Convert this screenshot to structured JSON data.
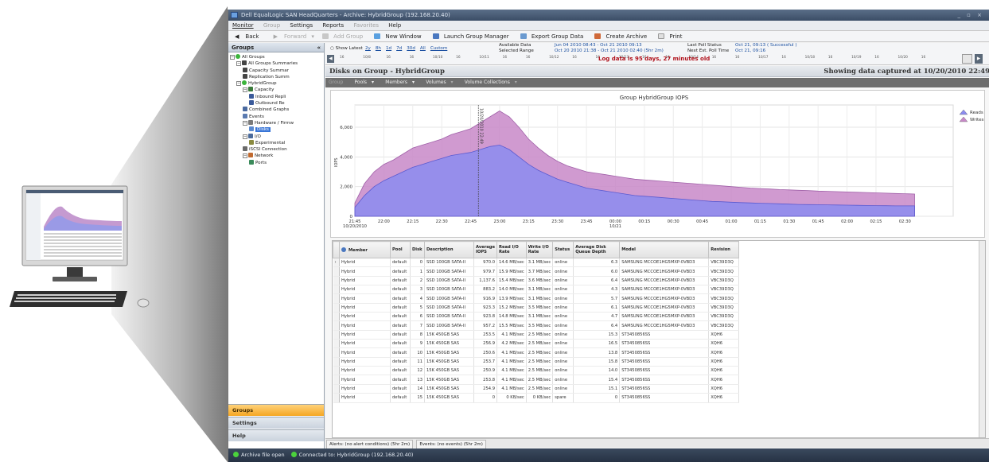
{
  "window": {
    "title": "Dell EqualLogic SAN HeadQuarters - Archive: HybridGroup (192.168.20.40)",
    "controls": "_ ▫ ×"
  },
  "menu": {
    "monitor": "Monitor",
    "group": "Group",
    "settings": "Settings",
    "reports": "Reports",
    "favorites": "Favorites",
    "help": "Help"
  },
  "toolbar": {
    "back": "Back",
    "forward": "Forward",
    "add_group": "Add Group",
    "new_window": "New Window",
    "launch_group_manager": "Launch Group Manager",
    "export_group_data": "Export Group Data",
    "create_archive": "Create Archive",
    "print": "Print"
  },
  "sidebar": {
    "title": "Groups",
    "collapse": "«",
    "tree": [
      {
        "label": "All Groups",
        "indent": 0,
        "expander": "−",
        "icon": "green-check-icon"
      },
      {
        "label": "All Groups Summaries",
        "indent": 1,
        "expander": "−",
        "icon": "sigma-icon"
      },
      {
        "label": "Capacity Summar",
        "indent": 2,
        "expander": "",
        "icon": "sigma-icon"
      },
      {
        "label": "Replication Summ",
        "indent": 2,
        "expander": "",
        "icon": "sigma-icon"
      },
      {
        "label": "HybridGroup",
        "indent": 1,
        "expander": "−",
        "icon": "green-check-icon"
      },
      {
        "label": "Capacity",
        "indent": 2,
        "expander": "−",
        "icon": "capacity-icon"
      },
      {
        "label": "Inbound Repli",
        "indent": 3,
        "expander": "",
        "icon": "inbound-icon"
      },
      {
        "label": "Outbound Re",
        "indent": 3,
        "expander": "",
        "icon": "outbound-icon"
      },
      {
        "label": "Combined Graphs",
        "indent": 2,
        "expander": "",
        "icon": "graph-icon"
      },
      {
        "label": "Events",
        "indent": 2,
        "expander": "",
        "icon": "events-icon"
      },
      {
        "label": "Hardware / Firmw",
        "indent": 2,
        "expander": "−",
        "icon": "hardware-icon"
      },
      {
        "label": "Disks",
        "indent": 3,
        "expander": "",
        "icon": "disk-icon",
        "selected": true
      },
      {
        "label": "I/O",
        "indent": 2,
        "expander": "−",
        "icon": "io-icon"
      },
      {
        "label": "Experimental",
        "indent": 3,
        "expander": "",
        "icon": "experimental-icon"
      },
      {
        "label": "iSCSI Connection",
        "indent": 2,
        "expander": "",
        "icon": "iscsi-icon"
      },
      {
        "label": "Network",
        "indent": 2,
        "expander": "−",
        "icon": "network-icon"
      },
      {
        "label": "Ports",
        "indent": 3,
        "expander": "",
        "icon": "ports-icon"
      }
    ],
    "nav": {
      "groups": "Groups",
      "settings": "Settings",
      "help": "Help"
    }
  },
  "timebar": {
    "show_latest": "Show Latest",
    "ranges": [
      "2y",
      "8h",
      "1d",
      "7d",
      "30d",
      "All",
      "Custom"
    ],
    "available_data_label": "Available Data",
    "available_data_value": "Jun 04 2010 08:43 - Oct 21 2010 09:13",
    "selected_range_label": "Selected Range",
    "selected_range_value": "Oct 20 2010 21:38 - Oct 21 2010 02:40 (5hr 2m)",
    "last_poll_label": "Last Poll Status",
    "last_poll_value": "Oct 21, 09:13 ( Successful )",
    "next_poll_label": "Next Est. Poll Time",
    "next_poll_value": "Oct 21, 09:16",
    "ticks": [
      "16",
      "10/8",
      "16",
      "16",
      "10/10",
      "16",
      "10/11",
      "16",
      "16",
      "10/12",
      "16",
      "16",
      "10/13",
      "16",
      "16",
      "10/14",
      "16",
      "16",
      "10/17",
      "16",
      "10/18",
      "16",
      "10/19",
      "16",
      "10/20",
      "16"
    ],
    "log_warning": "Log data is 95 days, 27 minutes old"
  },
  "header": {
    "title": "Disks on Group - HybridGroup",
    "captured": "Showing data captured at 10/20/2010 22:49"
  },
  "subtabs": {
    "group": "Group",
    "pools": "Pools",
    "members": "Members",
    "volumes": "Volumes",
    "volume_collections": "Volume Collections"
  },
  "chart_data": {
    "type": "area",
    "title": "Group HybridGroup IOPS",
    "ylabel": "IOPS",
    "xlabel": "",
    "ylim": [
      0,
      7500
    ],
    "yticks": [
      0,
      2000,
      4000,
      6000
    ],
    "ytick_labels": [
      "0",
      "2,000",
      "4,000",
      "6,000"
    ],
    "xtick_labels": [
      "21:45\n10/20/2010",
      "22:00",
      "22:15",
      "22:30",
      "22:45",
      "23:00",
      "23:15",
      "23:30",
      "23:45",
      "00:00\n10/21",
      "00:15",
      "00:30",
      "00:45",
      "01:00",
      "01:15",
      "01:30",
      "01:45",
      "02:00",
      "02:15",
      "02:30"
    ],
    "marker_label": "10/20/2010 22:49",
    "grid": true,
    "legend": "right",
    "x_minutes": [
      0,
      5,
      10,
      15,
      20,
      25,
      30,
      35,
      40,
      45,
      50,
      55,
      60,
      65,
      70,
      75,
      80,
      85,
      90,
      95,
      100,
      105,
      110,
      115,
      120,
      125,
      130,
      135,
      140,
      145,
      150,
      155,
      160,
      165,
      170,
      175,
      180,
      185,
      190,
      195,
      200,
      205,
      210,
      215,
      220,
      225,
      230,
      235,
      240,
      245,
      250,
      255,
      260,
      265,
      270,
      275,
      280,
      285,
      290
    ],
    "series": [
      {
        "name": "Reads",
        "color": "#8c8cf0",
        "values": [
          600,
          1400,
          2000,
          2400,
          2700,
          3000,
          3300,
          3500,
          3700,
          3900,
          4100,
          4200,
          4300,
          4500,
          4700,
          4800,
          4500,
          4000,
          3500,
          3100,
          2800,
          2500,
          2300,
          2100,
          1900,
          1800,
          1700,
          1600,
          1500,
          1400,
          1350,
          1300,
          1250,
          1200,
          1150,
          1100,
          1050,
          1000,
          980,
          950,
          920,
          900,
          880,
          860,
          840,
          820,
          800,
          790,
          780,
          770,
          760,
          750,
          740,
          730,
          720,
          710,
          700,
          700,
          700
        ]
      },
      {
        "name": "Writes",
        "color": "#c888c8",
        "values": [
          900,
          2200,
          3000,
          3500,
          3800,
          4200,
          4600,
          4800,
          5000,
          5200,
          5500,
          5700,
          5900,
          6300,
          6700,
          7100,
          6700,
          6000,
          5200,
          4600,
          4100,
          3700,
          3400,
          3200,
          3000,
          2900,
          2800,
          2700,
          2600,
          2500,
          2450,
          2400,
          2350,
          2300,
          2250,
          2200,
          2150,
          2100,
          2050,
          2000,
          1950,
          1900,
          1870,
          1840,
          1800,
          1780,
          1750,
          1730,
          1700,
          1680,
          1660,
          1640,
          1620,
          1600,
          1580,
          1560,
          1540,
          1520,
          1500
        ]
      }
    ]
  },
  "table": {
    "columns": [
      "Member",
      "Pool",
      "Disk",
      "Description",
      "Average IOPS",
      "Read I/O Rate",
      "Write I/O Rate",
      "Status",
      "Average Disk Queue Depth",
      "Model",
      "Revision"
    ],
    "rows": [
      [
        "Hybrid",
        "default",
        "0",
        "SSD 100GB SATA-II",
        "970.0",
        "14.6 MB/sec",
        "3.1 MB/sec",
        "online",
        "6.3",
        "SAMSUNG MCCOE1HG5MXP-0VBD3",
        "VBC39D3Q"
      ],
      [
        "Hybrid",
        "default",
        "1",
        "SSD 100GB SATA-II",
        "979.7",
        "15.9 MB/sec",
        "3.7 MB/sec",
        "online",
        "6.0",
        "SAMSUNG MCCOE1HG5MXP-0VBD3",
        "VBC39D3Q"
      ],
      [
        "Hybrid",
        "default",
        "2",
        "SSD 100GB SATA-II",
        "1,137.6",
        "15.4 MB/sec",
        "3.6 MB/sec",
        "online",
        "6.4",
        "SAMSUNG MCCOE1HG5MXP-0VBD3",
        "VBC39D3Q"
      ],
      [
        "Hybrid",
        "default",
        "3",
        "SSD 100GB SATA-II",
        "883.2",
        "14.0 MB/sec",
        "3.1 MB/sec",
        "online",
        "4.3",
        "SAMSUNG MCCOE1HG5MXP-0VBD3",
        "VBC39D3Q"
      ],
      [
        "Hybrid",
        "default",
        "4",
        "SSD 100GB SATA-II",
        "916.9",
        "13.9 MB/sec",
        "3.1 MB/sec",
        "online",
        "5.7",
        "SAMSUNG MCCOE1HG5MXP-0VBD3",
        "VBC39D3Q"
      ],
      [
        "Hybrid",
        "default",
        "5",
        "SSD 100GB SATA-II",
        "923.3",
        "15.2 MB/sec",
        "3.5 MB/sec",
        "online",
        "6.1",
        "SAMSUNG MCCOE1HG5MXP-0VBD3",
        "VBC39D3Q"
      ],
      [
        "Hybrid",
        "default",
        "6",
        "SSD 100GB SATA-II",
        "923.8",
        "14.8 MB/sec",
        "3.1 MB/sec",
        "online",
        "4.7",
        "SAMSUNG MCCOE1HG5MXP-0VBD3",
        "VBC39D3Q"
      ],
      [
        "Hybrid",
        "default",
        "7",
        "SSD 100GB SATA-II",
        "957.2",
        "15.5 MB/sec",
        "3.5 MB/sec",
        "online",
        "6.4",
        "SAMSUNG MCCOE1HG5MXP-0VBD3",
        "VBC39D3Q"
      ],
      [
        "Hybrid",
        "default",
        "8",
        "15K 450GB SAS",
        "253.5",
        "4.1 MB/sec",
        "2.5 MB/sec",
        "online",
        "15.3",
        "ST3450856SS",
        "XQH6"
      ],
      [
        "Hybrid",
        "default",
        "9",
        "15K 450GB SAS",
        "256.9",
        "4.2 MB/sec",
        "2.5 MB/sec",
        "online",
        "16.5",
        "ST3450856SS",
        "XQH6"
      ],
      [
        "Hybrid",
        "default",
        "10",
        "15K 450GB SAS",
        "250.6",
        "4.1 MB/sec",
        "2.5 MB/sec",
        "online",
        "13.8",
        "ST3450856SS",
        "XQH6"
      ],
      [
        "Hybrid",
        "default",
        "11",
        "15K 450GB SAS",
        "253.7",
        "4.1 MB/sec",
        "2.5 MB/sec",
        "online",
        "15.8",
        "ST3450856SS",
        "XQH6"
      ],
      [
        "Hybrid",
        "default",
        "12",
        "15K 450GB SAS",
        "250.9",
        "4.1 MB/sec",
        "2.5 MB/sec",
        "online",
        "14.0",
        "ST3450856SS",
        "XQH6"
      ],
      [
        "Hybrid",
        "default",
        "13",
        "15K 450GB SAS",
        "253.8",
        "4.1 MB/sec",
        "2.5 MB/sec",
        "online",
        "15.4",
        "ST3450856SS",
        "XQH6"
      ],
      [
        "Hybrid",
        "default",
        "14",
        "15K 450GB SAS",
        "254.9",
        "4.1 MB/sec",
        "2.5 MB/sec",
        "online",
        "15.1",
        "ST3450856SS",
        "XQH6"
      ],
      [
        "Hybrid",
        "default",
        "15",
        "15K 450GB SAS",
        "0",
        "0 KB/sec",
        "0 KB/sec",
        "spare",
        "0",
        "ST3450856SS",
        "XQH6"
      ]
    ]
  },
  "bottom_tabs": {
    "alerts": "Alerts: (no alert conditions) (5hr 2m)",
    "events": "Events: (no events) (5hr 2m)"
  },
  "status": {
    "archive": "Archive file open",
    "connected": "Connected to: HybridGroup (192.168.20.40)"
  },
  "colors": {
    "accent_orange": "#f5a623",
    "reads": "#8c8cf0",
    "writes": "#c888c8",
    "status_ok": "#4bd23c",
    "warning_red": "#b0101a"
  }
}
